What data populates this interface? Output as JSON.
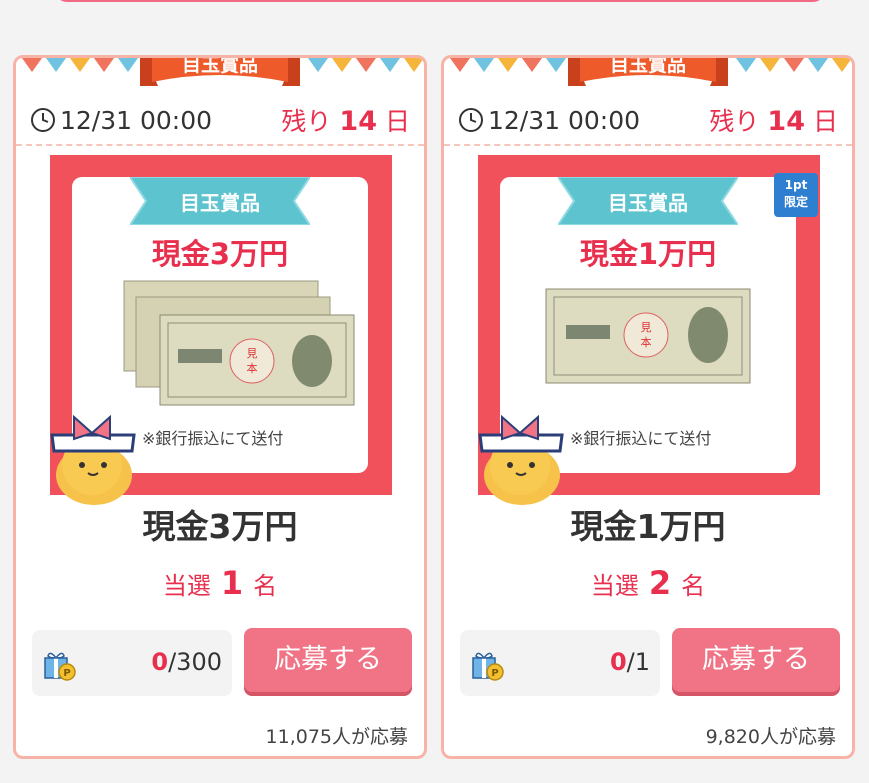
{
  "cards": [
    {
      "ribbon_label": "目玉賞品",
      "date": "12/31 00:00",
      "remain_prefix": "残り",
      "remain_days": "14",
      "remain_suffix": "日",
      "tag_label": "目玉賞品",
      "cash_title": "現金3万円",
      "note": "※銀行振込にて送付",
      "prize_name": "現金3万円",
      "winners_prefix": "当選",
      "winners_count": "1",
      "winners_suffix": "名",
      "points_current": "0",
      "points_total": "/300",
      "apply_label": "応募する",
      "applicants": "11,075人が応募",
      "bill_count": 3
    },
    {
      "ribbon_label": "目玉賞品",
      "date": "12/31 00:00",
      "remain_prefix": "残り",
      "remain_days": "14",
      "remain_suffix": "日",
      "tag_label": "目玉賞品",
      "cash_title": "現金1万円",
      "note": "※銀行振込にて送付",
      "prize_name": "現金1万円",
      "winners_prefix": "当選",
      "winners_count": "2",
      "winners_suffix": "名",
      "points_current": "0",
      "points_total": "/1",
      "apply_label": "応募する",
      "applicants": "9,820人が応募",
      "pt_badge_line1": "1pt",
      "pt_badge_line2": "限定",
      "bill_count": 1
    }
  ],
  "colors": {
    "accent_red": "#e8304e",
    "card_border": "#f6b3a6",
    "button_pink": "#f07485",
    "tag_teal": "#5cc3cf",
    "ribbon_orange": "#ef5a2a"
  },
  "icons": [
    "clock-icon",
    "gift-points-icon",
    "mascot-cat"
  ]
}
